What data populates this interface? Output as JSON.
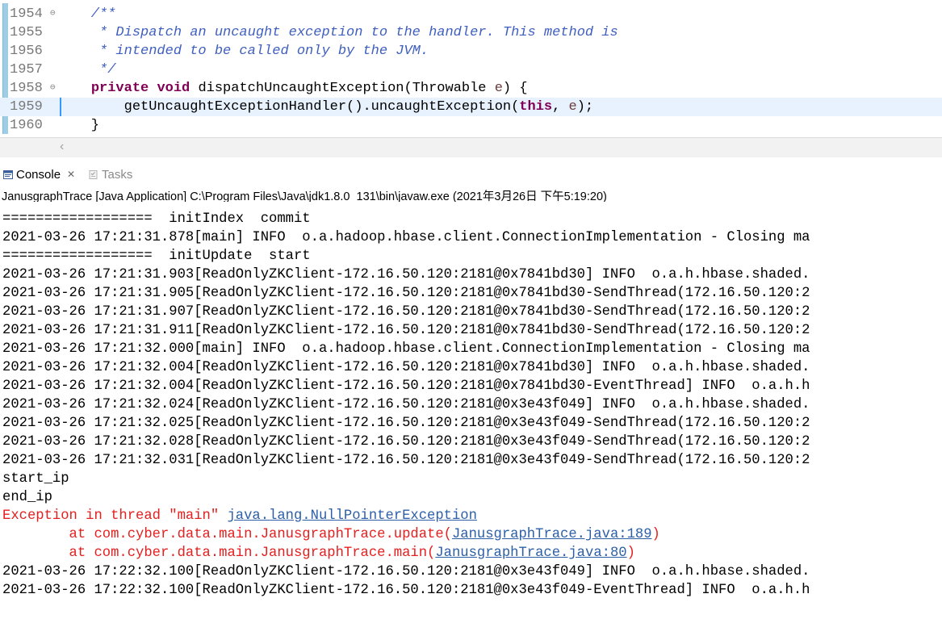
{
  "editor": {
    "lines": [
      {
        "num": "1954",
        "fold": true,
        "parts": [
          {
            "t": "    /**",
            "c": "cm"
          }
        ]
      },
      {
        "num": "1955",
        "fold": false,
        "parts": [
          {
            "t": "     * Dispatch an uncaught exception to the handler. This method is",
            "c": "cm"
          }
        ]
      },
      {
        "num": "1956",
        "fold": false,
        "parts": [
          {
            "t": "     * intended to be called only by the JVM.",
            "c": "cm"
          }
        ]
      },
      {
        "num": "1957",
        "fold": false,
        "parts": [
          {
            "t": "     */",
            "c": "cm"
          }
        ]
      },
      {
        "num": "1958",
        "fold": true,
        "parts": [
          {
            "t": "    ",
            "c": "pl"
          },
          {
            "t": "private",
            "c": "kw"
          },
          {
            "t": " ",
            "c": "pl"
          },
          {
            "t": "void",
            "c": "kw"
          },
          {
            "t": " dispatchUncaughtException(Throwable ",
            "c": "pl"
          },
          {
            "t": "e",
            "c": "pv"
          },
          {
            "t": ") {",
            "c": "pl"
          }
        ]
      },
      {
        "num": "1959",
        "fold": false,
        "current": true,
        "parts": [
          {
            "t": "        getUncaughtExceptionHandler().uncaughtException(",
            "c": "pl"
          },
          {
            "t": "this",
            "c": "kw"
          },
          {
            "t": ", ",
            "c": "pl"
          },
          {
            "t": "e",
            "c": "pv"
          },
          {
            "t": ");",
            "c": "pl"
          }
        ]
      },
      {
        "num": "1960",
        "fold": false,
        "parts": [
          {
            "t": "    }",
            "c": "pl"
          }
        ]
      }
    ]
  },
  "console": {
    "tabs": {
      "console": "Console",
      "tasks": "Tasks"
    },
    "description": "JanusgraphTrace [Java Application] C:\\Program Files\\Java\\jdk1.8.0_131\\bin\\javaw.exe (2021年3月26日 下午5:19:20)",
    "lines": [
      {
        "text": "==================  initIndex  commit"
      },
      {
        "text": "2021-03-26 17:21:31.878[main] INFO  o.a.hadoop.hbase.client.ConnectionImplementation - Closing ma"
      },
      {
        "text": "==================  initUpdate  start"
      },
      {
        "text": "2021-03-26 17:21:31.903[ReadOnlyZKClient-172.16.50.120:2181@0x7841bd30] INFO  o.a.h.hbase.shaded."
      },
      {
        "text": "2021-03-26 17:21:31.905[ReadOnlyZKClient-172.16.50.120:2181@0x7841bd30-SendThread(172.16.50.120:2"
      },
      {
        "text": "2021-03-26 17:21:31.907[ReadOnlyZKClient-172.16.50.120:2181@0x7841bd30-SendThread(172.16.50.120:2"
      },
      {
        "text": "2021-03-26 17:21:31.911[ReadOnlyZKClient-172.16.50.120:2181@0x7841bd30-SendThread(172.16.50.120:2"
      },
      {
        "text": "2021-03-26 17:21:32.000[main] INFO  o.a.hadoop.hbase.client.ConnectionImplementation - Closing ma"
      },
      {
        "text": "2021-03-26 17:21:32.004[ReadOnlyZKClient-172.16.50.120:2181@0x7841bd30] INFO  o.a.h.hbase.shaded."
      },
      {
        "text": "2021-03-26 17:21:32.004[ReadOnlyZKClient-172.16.50.120:2181@0x7841bd30-EventThread] INFO  o.a.h.h"
      },
      {
        "text": "2021-03-26 17:21:32.024[ReadOnlyZKClient-172.16.50.120:2181@0x3e43f049] INFO  o.a.h.hbase.shaded."
      },
      {
        "text": "2021-03-26 17:21:32.025[ReadOnlyZKClient-172.16.50.120:2181@0x3e43f049-SendThread(172.16.50.120:2"
      },
      {
        "text": "2021-03-26 17:21:32.028[ReadOnlyZKClient-172.16.50.120:2181@0x3e43f049-SendThread(172.16.50.120:2"
      },
      {
        "text": "2021-03-26 17:21:32.031[ReadOnlyZKClient-172.16.50.120:2181@0x3e43f049-SendThread(172.16.50.120:2"
      },
      {
        "text": "start_ip"
      },
      {
        "text": "end_ip"
      },
      {
        "err": true,
        "text": "Exception in thread \"main\" ",
        "link": "java.lang.NullPointerException",
        "after": ""
      },
      {
        "err": true,
        "text": "        at com.cyber.data.main.JanusgraphTrace.update(",
        "link": "JanusgraphTrace.java:189",
        "after": ")"
      },
      {
        "err": true,
        "text": "        at com.cyber.data.main.JanusgraphTrace.main(",
        "link": "JanusgraphTrace.java:80",
        "after": ")"
      },
      {
        "text": "2021-03-26 17:22:32.100[ReadOnlyZKClient-172.16.50.120:2181@0x3e43f049] INFO  o.a.h.hbase.shaded."
      },
      {
        "text": "2021-03-26 17:22:32.100[ReadOnlyZKClient-172.16.50.120:2181@0x3e43f049-EventThread] INFO  o.a.h.h"
      }
    ]
  }
}
